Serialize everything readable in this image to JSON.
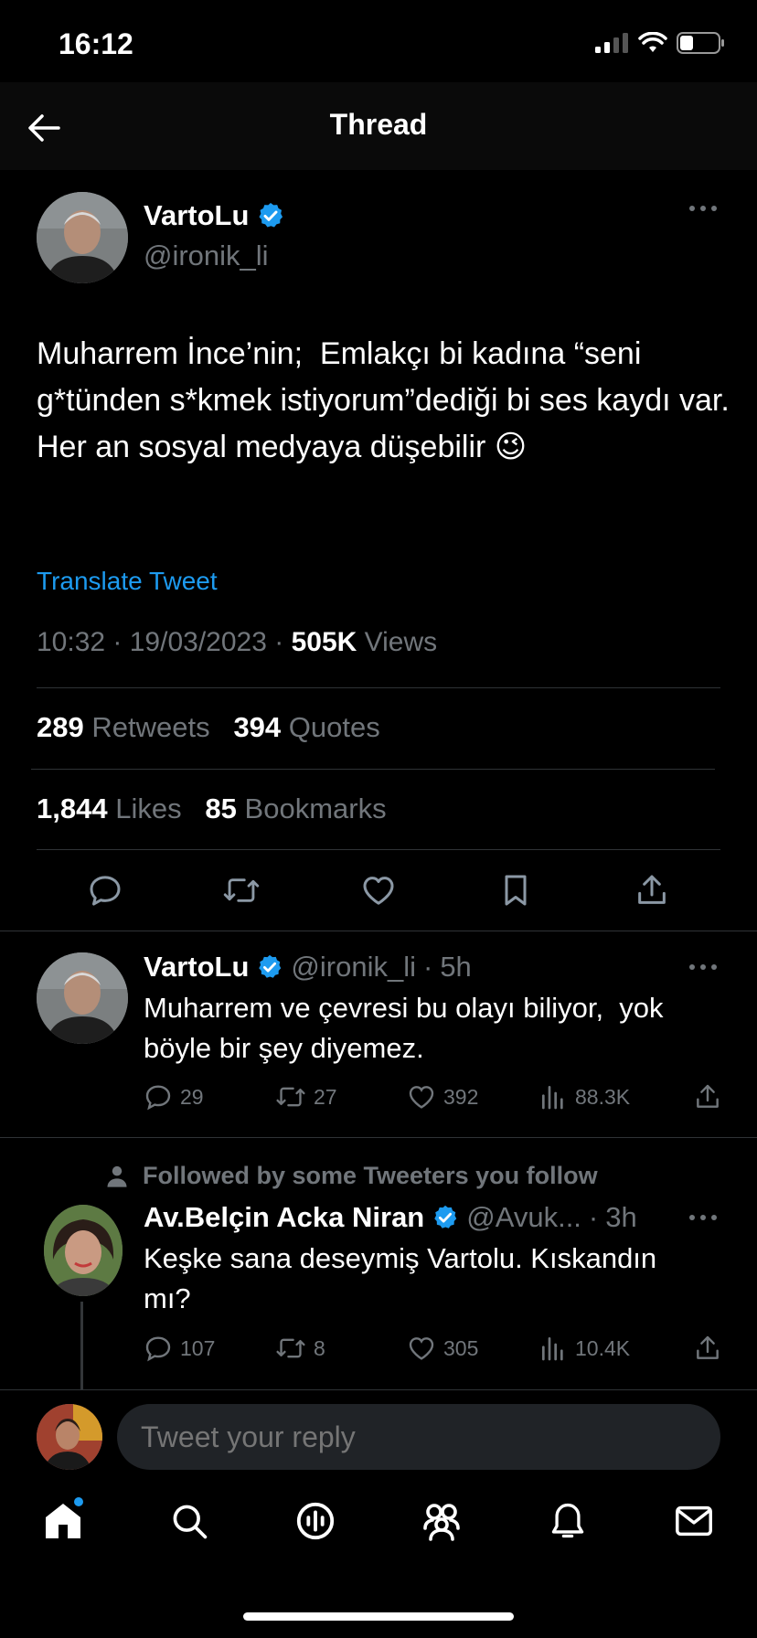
{
  "status_bar": {
    "time": "16:12"
  },
  "header": {
    "title": "Thread"
  },
  "main_tweet": {
    "author_name": "VartoLu",
    "handle": "@ironik_li",
    "text": "Muharrem İnce’nin;  Emlakçı bi kadına “seni g*tünden s*kmek istiyorum”dediği bi ses kaydı var.\nHer an sosyal medyaya düşebilir 😉",
    "translate_label": "Translate Tweet",
    "time": "10:32",
    "date": "19/03/2023",
    "views_count": "505K",
    "views_label": "Views",
    "retweets_count": "289",
    "retweets_label": "Retweets",
    "quotes_count": "394",
    "quotes_label": "Quotes",
    "likes_count": "1,844",
    "likes_label": "Likes",
    "bookmarks_count": "85",
    "bookmarks_label": "Bookmarks"
  },
  "replies": [
    {
      "author_name": "VartoLu",
      "handle": "@ironik_li",
      "age": "5h",
      "text": "Muharrem ve çevresi bu olayı biliyor,  yok\nböyle bir şey diyemez.",
      "replies": "29",
      "retweets": "27",
      "likes": "392",
      "views": "88.3K"
    },
    {
      "context": "Followed by some Tweeters you follow",
      "author_name": "Av.Belçin Acka Niran",
      "handle": "@Avuk...",
      "age": "3h",
      "text": "Keşke sana deseymiş Vartolu. Kıskandın\nmı?",
      "replies": "107",
      "retweets": "8",
      "likes": "305",
      "views": "10.4K"
    }
  ],
  "composer": {
    "placeholder": "Tweet your reply"
  },
  "colors": {
    "accent": "#1d9bf0",
    "background": "#000000",
    "secondary_text": "#71767b"
  },
  "icons": [
    "back-arrow-icon",
    "verified-badge-icon",
    "more-icon",
    "reply-icon",
    "retweet-icon",
    "like-icon",
    "bookmark-icon",
    "share-icon",
    "views-icon",
    "person-icon",
    "home-icon",
    "search-icon",
    "spaces-icon",
    "communities-icon",
    "notifications-icon",
    "messages-icon"
  ]
}
